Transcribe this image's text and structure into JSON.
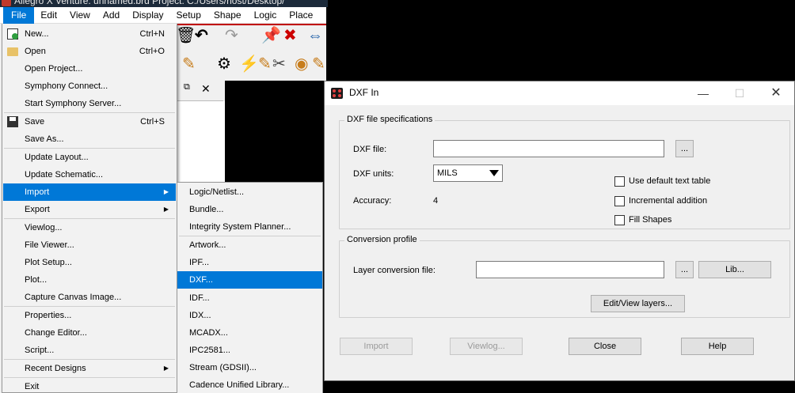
{
  "app": {
    "title": "Allegro X Venture: unnamed.brd  Project: C:/Users/host/Desktop/"
  },
  "menubar": [
    "File",
    "Edit",
    "View",
    "Add",
    "Display",
    "Setup",
    "Shape",
    "Logic",
    "Place"
  ],
  "file_menu": {
    "items": [
      {
        "label": "New...",
        "shortcut": "Ctrl+N",
        "icon": "new-file-icon"
      },
      {
        "label": "Open",
        "shortcut": "Ctrl+O",
        "icon": "folder-icon"
      },
      {
        "label": "Open Project...",
        "shortcut": ""
      },
      {
        "label": "Symphony Connect...",
        "shortcut": ""
      },
      {
        "label": "Start Symphony Server...",
        "shortcut": ""
      },
      {
        "label": "Save",
        "shortcut": "Ctrl+S",
        "icon": "save-icon"
      },
      {
        "label": "Save As...",
        "shortcut": ""
      },
      {
        "label": "Update Layout...",
        "shortcut": ""
      },
      {
        "label": "Update Schematic...",
        "shortcut": ""
      },
      {
        "label": "Import",
        "shortcut": "",
        "submenu": true
      },
      {
        "label": "Export",
        "shortcut": "",
        "submenu": true
      },
      {
        "label": "Viewlog...",
        "shortcut": ""
      },
      {
        "label": "File Viewer...",
        "shortcut": ""
      },
      {
        "label": "Plot Setup...",
        "shortcut": ""
      },
      {
        "label": "Plot...",
        "shortcut": ""
      },
      {
        "label": "Capture Canvas Image...",
        "shortcut": ""
      },
      {
        "label": "Properties...",
        "shortcut": ""
      },
      {
        "label": "Change Editor...",
        "shortcut": ""
      },
      {
        "label": "Script...",
        "shortcut": ""
      },
      {
        "label": "Recent Designs",
        "shortcut": "",
        "submenu": true
      },
      {
        "label": "Exit",
        "shortcut": ""
      }
    ],
    "highlighted": "Import"
  },
  "import_submenu": {
    "items": [
      "Logic/Netlist...",
      "Bundle...",
      "Integrity System Planner...",
      "Artwork...",
      "IPF...",
      "DXF...",
      "IDF...",
      "IDX...",
      "MCADX...",
      "IPC2581...",
      "Stream (GDSII)...",
      "Cadence Unified Library..."
    ],
    "highlighted": "DXF..."
  },
  "dialog": {
    "title": "DXF In",
    "spec_group": "DXF file specifications",
    "dxf_file_label": "DXF file:",
    "dxf_file_value": "",
    "browse_label": "...",
    "units_label": "DXF units:",
    "units_value": "MILS",
    "accuracy_label": "Accuracy:",
    "accuracy_value": "4",
    "checkboxes": [
      {
        "label": "Use default text table",
        "checked": false
      },
      {
        "label": "Incremental addition",
        "checked": false
      },
      {
        "label": "Fill Shapes",
        "checked": false
      }
    ],
    "profile_group": "Conversion profile",
    "layer_file_label": "Layer conversion file:",
    "layer_file_value": "",
    "lib_button": "Lib...",
    "edit_layers_button": "Edit/View layers...",
    "buttons": {
      "import": "Import",
      "viewlog": "Viewlog...",
      "close": "Close",
      "help": "Help"
    }
  }
}
